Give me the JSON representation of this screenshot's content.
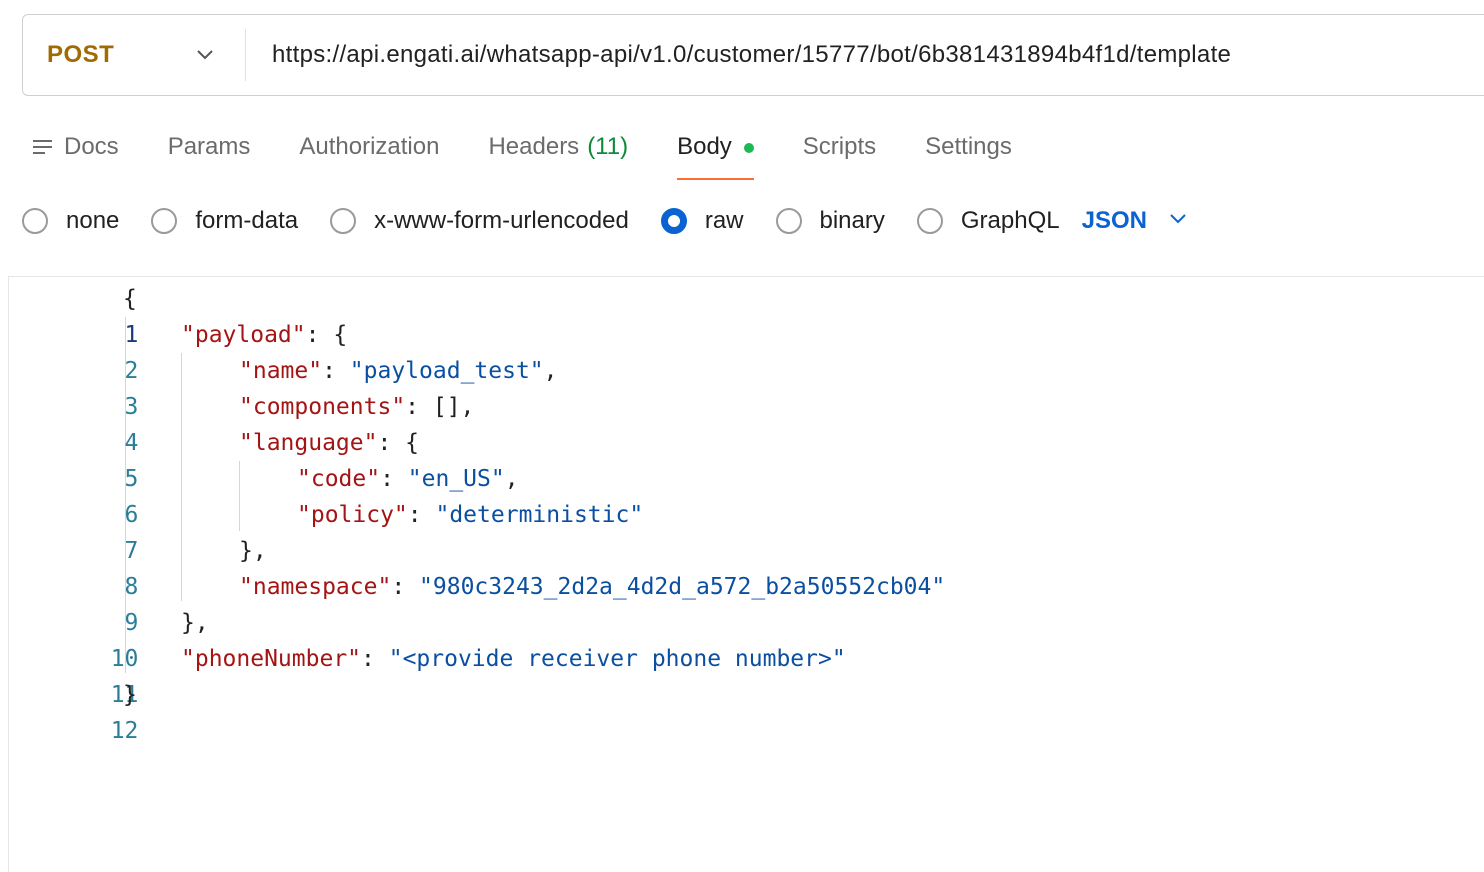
{
  "request": {
    "method": "POST",
    "url": "https://api.engati.ai/whatsapp-api/v1.0/customer/15777/bot/6b381431894b4f1d/template"
  },
  "tabs": [
    {
      "label": "Docs"
    },
    {
      "label": "Params"
    },
    {
      "label": "Authorization"
    },
    {
      "label": "Headers",
      "count": "(11)"
    },
    {
      "label": "Body"
    },
    {
      "label": "Scripts"
    },
    {
      "label": "Settings"
    }
  ],
  "body_types": [
    {
      "label": "none",
      "checked": false
    },
    {
      "label": "form-data",
      "checked": false
    },
    {
      "label": "x-www-form-urlencoded",
      "checked": false
    },
    {
      "label": "raw",
      "checked": true
    },
    {
      "label": "binary",
      "checked": false
    },
    {
      "label": "GraphQL",
      "checked": false
    }
  ],
  "raw_language": "JSON",
  "editor": {
    "line_numbers": [
      "1",
      "2",
      "3",
      "4",
      "5",
      "6",
      "7",
      "8",
      "9",
      "10",
      "11",
      "12"
    ],
    "code": {
      "l1_open": "{",
      "payload_key": "\"payload\"",
      "payload_colon": ": {",
      "name_key": "\"name\"",
      "name_colon": ": ",
      "name_val": "\"payload_test\"",
      "name_comma": ",",
      "components_key": "\"components\"",
      "components_rest": ": [],",
      "language_key": "\"language\"",
      "language_colon": ": {",
      "code_key": "\"code\"",
      "code_colon": ": ",
      "code_val": "\"en_US\"",
      "code_comma": ",",
      "policy_key": "\"policy\"",
      "policy_colon": ": ",
      "policy_val": "\"deterministic\"",
      "language_close": "},",
      "namespace_key": "\"namespace\"",
      "namespace_colon": ": ",
      "namespace_val": "\"980c3243_2d2a_4d2d_a572_b2a50552cb04\"",
      "payload_close": "},",
      "phone_key": "\"phoneNumber\"",
      "phone_colon": ": ",
      "phone_val": "\"<provide receiver phone number>\"",
      "l12_close": "}"
    }
  }
}
